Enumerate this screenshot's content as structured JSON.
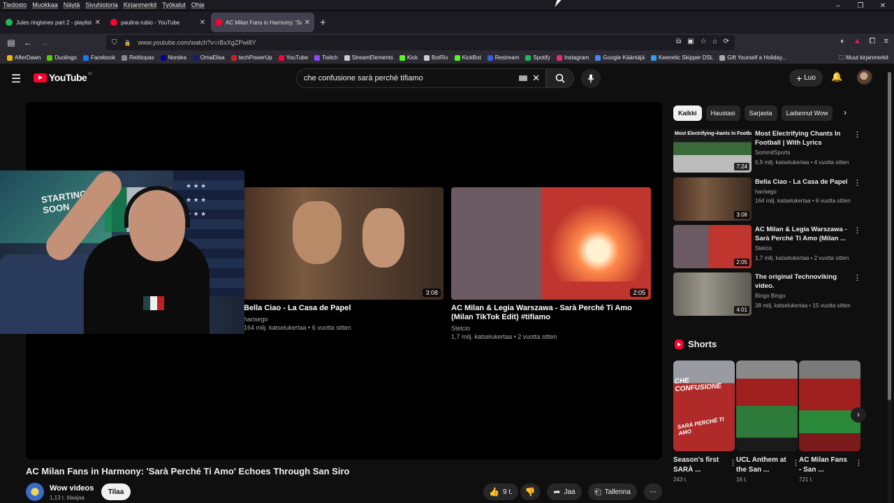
{
  "menubar": {
    "items": [
      "Tiedosto",
      "Muokkaa",
      "Näytä",
      "Sivuhistoria",
      "Kirjanmerkit",
      "Työkalut",
      "Ohje"
    ]
  },
  "window_controls": {
    "minimize": "–",
    "restore": "❐",
    "close": "✕"
  },
  "tabs": [
    {
      "label": "Jules ringtones part 2 - playlist",
      "favicon_color": "#1db954",
      "active": false
    },
    {
      "label": "paulina rubio - YouTube",
      "favicon_color": "#ff0033",
      "active": false
    },
    {
      "label": "AC Milan Fans in Harmony: 'Sarà",
      "favicon_color": "#ff0033",
      "active": true
    }
  ],
  "tab_close": "✕",
  "new_tab": "+",
  "nav": {
    "back": "←",
    "forward": "→",
    "reload": "⟳",
    "home": "⌂",
    "sidebar": "▤"
  },
  "url": {
    "value": "www.youtube.com/watch?v=rBxXgZPwi8Y",
    "lock_icon": "🔒",
    "shield_icon": "⛉"
  },
  "bookmarks": [
    {
      "label": "AfterDawn",
      "color": "#e6b800"
    },
    {
      "label": "Duolingo",
      "color": "#58cc02"
    },
    {
      "label": "Facebook",
      "color": "#1877f2"
    },
    {
      "label": "Reittiopas",
      "color": "#888888"
    },
    {
      "label": "Nordea",
      "color": "#0000a0"
    },
    {
      "label": "OmaElisa",
      "color": "#1a1a6a"
    },
    {
      "label": "techPowerUp",
      "color": "#cc2222"
    },
    {
      "label": "YouTube",
      "color": "#ff0033"
    },
    {
      "label": "Twitch",
      "color": "#9146ff"
    },
    {
      "label": "StreamElements",
      "color": "#cccccc"
    },
    {
      "label": "Kick",
      "color": "#53fc18"
    },
    {
      "label": "BotRix",
      "color": "#cccccc"
    },
    {
      "label": "KickBot",
      "color": "#53fc18"
    },
    {
      "label": "Restream",
      "color": "#3b5bdb"
    },
    {
      "label": "Spotify",
      "color": "#1db954"
    },
    {
      "label": "Instagram",
      "color": "#e1306c"
    },
    {
      "label": "Google Kääntäjä",
      "color": "#4285f4"
    },
    {
      "label": "Keenetic Skipper DSL",
      "color": "#2a9df4"
    },
    {
      "label": "Gift Yourself a Holiday...",
      "color": "#aaaaaa"
    }
  ],
  "bookmarks_other": "Muut kirjanmerkit",
  "yt": {
    "brand": "YouTube",
    "region": "FI",
    "search_value": "che confusione sarà perchè tifiamo",
    "create_label": "Luo",
    "create_plus": "+"
  },
  "player": {
    "endcards": [
      {
        "title": "Bella Ciao - La Casa de Papel",
        "channel": "harisego",
        "stats": "164 milj. katselukertaa • 6 vuotta sitten",
        "duration": "3:08"
      },
      {
        "title": "AC Milan & Legia Warszawa - Sarà Perché Ti Amo (Milan TikTok Edit) #tifiamo",
        "channel": "Stelcio",
        "stats": "1,7 milj. katselukertaa • 2 vuotta sitten",
        "duration": "2:05"
      }
    ]
  },
  "video": {
    "title": "AC Milan Fans in Harmony: 'Sarà Perché Ti Amo' Echoes Through San Siro",
    "channel": "Wow videos",
    "subscribers": "1,13 t. tilaajaa",
    "subscribe_label": "Tilaa",
    "likes": "9 t.",
    "share_label": "Jaa",
    "save_label": "Tallenna",
    "more": "⋯"
  },
  "chips": [
    "Kaikki",
    "Haustasi",
    "Sarjasta",
    "Ladannut Wow"
  ],
  "recommendations": [
    {
      "title": "Most Electrifying Chants In Football | With Lyrics",
      "channel": "SommitSports",
      "stats": "6,9 milj. katselukertaa • 4 vuotta sitten",
      "duration": "7:24"
    },
    {
      "title": "Bella Ciao - La Casa de Papel",
      "channel": "harisego",
      "stats": "164 milj. katselukertaa • 6 vuotta sitten",
      "duration": "3:08"
    },
    {
      "title": "AC Milan & Legia Warszawa - Sarà Perché Ti Amo (Milan ...",
      "channel": "Stelcio",
      "stats": "1,7 milj. katselukertaa • 2 vuotta sitten",
      "duration": "2:05"
    },
    {
      "title": "The original Technoviking video.",
      "channel": "Bingo Bingo",
      "stats": "38 milj. katselukertaa • 15 vuotta sitten",
      "duration": "4:01"
    }
  ],
  "shorts": {
    "heading": "Shorts",
    "items": [
      {
        "title": "Season's first SARÀ ...",
        "views": "243 t.",
        "caption": "CHE CONFUSIONE",
        "caption2": "SARÀ PERCHÉ TI AMO"
      },
      {
        "title": "UCL Anthem at the San ...",
        "views": "16 t."
      },
      {
        "title": "AC Milan Fans - San ...",
        "views": "721 t."
      }
    ]
  }
}
